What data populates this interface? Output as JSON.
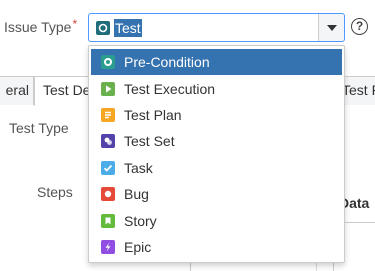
{
  "field": {
    "label": "Issue Type",
    "required_mark": "*",
    "selected_value": "Test",
    "selected_icon": "test-icon",
    "help_glyph": "?"
  },
  "tabs": {
    "general": "eral",
    "test_details": "Test De",
    "right": "Test F"
  },
  "labels": {
    "test_type": "Test Type",
    "steps": "Steps"
  },
  "table": {
    "data_header": "Data"
  },
  "dropdown": {
    "options": [
      {
        "label": "Pre-Condition",
        "icon": "pre-condition-icon",
        "color": "#2a9d8f",
        "selected": true
      },
      {
        "label": "Test Execution",
        "icon": "test-execution-icon",
        "color": "#6ab04c"
      },
      {
        "label": "Test Plan",
        "icon": "test-plan-icon",
        "color": "#f5a623"
      },
      {
        "label": "Test Set",
        "icon": "test-set-icon",
        "color": "#5243aa"
      },
      {
        "label": "Task",
        "icon": "task-icon",
        "color": "#4bade8"
      },
      {
        "label": "Bug",
        "icon": "bug-icon",
        "color": "#e5493a"
      },
      {
        "label": "Story",
        "icon": "story-icon",
        "color": "#63ba3c"
      },
      {
        "label": "Epic",
        "icon": "epic-icon",
        "color": "#904ee2"
      }
    ]
  },
  "colors": {
    "accent": "#3572b0",
    "focus_border": "#4c9aff",
    "test_icon": "#1f6d7a"
  }
}
